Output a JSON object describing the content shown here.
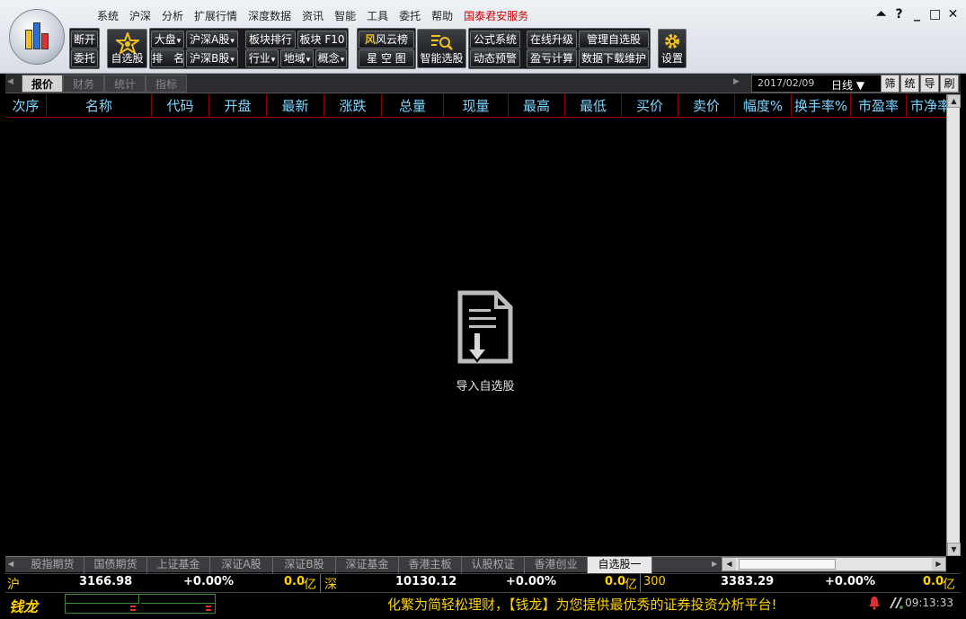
{
  "menu": [
    "系统",
    "沪深",
    "分析",
    "扩展行情",
    "深度数据",
    "资讯",
    "智能",
    "工具",
    "委托",
    "帮助"
  ],
  "menu_brand": "国泰君安服务",
  "window_controls": [
    "⏶",
    "?",
    "_",
    "□",
    "✕"
  ],
  "toolbar": {
    "g1": [
      "断开",
      "委托"
    ],
    "fav": "自选股",
    "g2": [
      [
        "大盘",
        "沪深A股",
        "板块排行",
        "板块 F10"
      ],
      [
        "排　名",
        "沪深B股",
        "行业",
        "地域",
        "概念"
      ]
    ],
    "g3": [
      "风云榜",
      "星 空 图"
    ],
    "smart": "智能选股",
    "g4": [
      [
        "公式系统",
        "在线升级",
        "管理自选股"
      ],
      [
        "动态预警",
        "盈亏计算",
        "数据下载维护"
      ]
    ],
    "settings": "设置"
  },
  "view_tabs": [
    "报价",
    "财务",
    "统计",
    "指标"
  ],
  "date": "2017/02/09",
  "period": "日线 ▼",
  "side_buttons": [
    "筛",
    "统",
    "导",
    "刷"
  ],
  "columns": [
    "次序",
    "名称",
    "代码",
    "开盘",
    "最新",
    "涨跌",
    "总量",
    "现量",
    "最高",
    "最低",
    "买价",
    "卖价",
    "幅度%",
    "换手率%",
    "市盈率",
    "市净率"
  ],
  "empty_state": "导入自选股",
  "sheet_tabs": [
    "股指期货",
    "国债期货",
    "上证基金",
    "深证A股",
    "深证B股",
    "深证基金",
    "香港主板",
    "认股权证",
    "香港创业",
    "自选股一"
  ],
  "index": {
    "sh_label": "沪",
    "sh_value": "3166.98",
    "sh_change": "+0.00%",
    "sh_amount": "0.0",
    "sh_unit": "亿",
    "sz_label": "深",
    "sz_value": "10130.12",
    "sz_change": "+0.00%",
    "sz_amount": "0.0",
    "sz_unit": "亿",
    "hs_label": "300",
    "hs_value": "3383.29",
    "hs_change": "+0.00%",
    "hs_amount": "0.0",
    "hs_unit": "亿"
  },
  "status": {
    "logo_text": "钱龙",
    "ticker": "化繁为简轻松理财，【钱龙】为您提供最优秀的证券投资分析平台!",
    "time": "09:13:33"
  },
  "colors": {
    "header_text": "#7fd6ff",
    "grid_line": "#8b0000",
    "ticker": "#ffd400",
    "brand": "#d00000"
  }
}
